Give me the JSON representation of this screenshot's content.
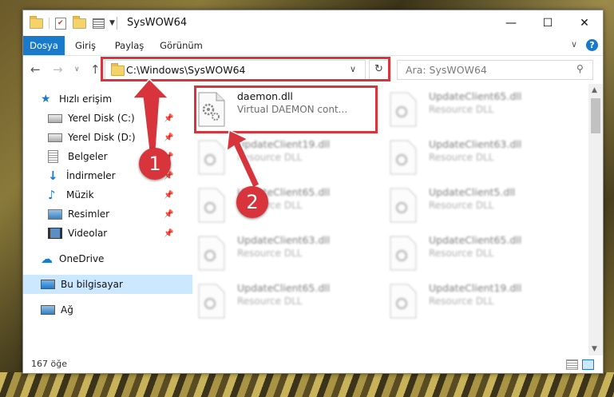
{
  "window": {
    "title": "SysWOW64",
    "minimize": "—",
    "maximize": "☐",
    "close": "✕"
  },
  "ribbon": {
    "tabs": [
      {
        "label": "Dosya"
      },
      {
        "label": "Giriş"
      },
      {
        "label": "Paylaş"
      },
      {
        "label": "Görünüm"
      }
    ],
    "collapse": "∨",
    "help": "?"
  },
  "address": {
    "path": "C:\\Windows\\SysWOW64",
    "dropdown": "∨",
    "refresh": "↻",
    "search_placeholder": "Ara: SysWOW64"
  },
  "sidebar": {
    "items": [
      {
        "label": "Hızlı erişim",
        "icon": "star-icon"
      },
      {
        "label": "Yerel Disk (C:)",
        "icon": "drive-icon"
      },
      {
        "label": "Yerel Disk (D:)",
        "icon": "drive-icon"
      },
      {
        "label": "Belgeler",
        "icon": "documents-icon"
      },
      {
        "label": "İndirmeler",
        "icon": "download-icon"
      },
      {
        "label": "Müzik",
        "icon": "music-icon"
      },
      {
        "label": "Resimler",
        "icon": "pictures-icon"
      },
      {
        "label": "Videolar",
        "icon": "videos-icon"
      },
      {
        "label": "OneDrive",
        "icon": "cloud-icon"
      },
      {
        "label": "Bu bilgisayar",
        "icon": "computer-icon"
      },
      {
        "label": "Ağ",
        "icon": "network-icon"
      }
    ]
  },
  "files": {
    "main": {
      "name": "daemon.dll",
      "desc": "Virtual DAEMON cont..."
    },
    "blurred": [
      {
        "name": "UpdateClient65.dll",
        "desc": "Resource DLL"
      },
      {
        "name": "UpdateClient19.dll",
        "desc": "Resource DLL"
      },
      {
        "name": "UpdateClient63.dll",
        "desc": "Resource DLL"
      },
      {
        "name": "UpdateClient65.dll",
        "desc": "Resource DLL"
      },
      {
        "name": "UpdateClient5.dll",
        "desc": "Resource DLL"
      },
      {
        "name": "UpdateClient63.dll",
        "desc": "Resource DLL"
      },
      {
        "name": "UpdateClient65.dll",
        "desc": "Resource DLL"
      },
      {
        "name": "UpdateClient65.dll",
        "desc": "Resource DLL"
      },
      {
        "name": "UpdateClient19.dll",
        "desc": "Resource DLL"
      }
    ]
  },
  "status": {
    "count": "167 öğe"
  },
  "annotations": {
    "badge1": "1",
    "badge2": "2",
    "color": "#d8343b"
  }
}
